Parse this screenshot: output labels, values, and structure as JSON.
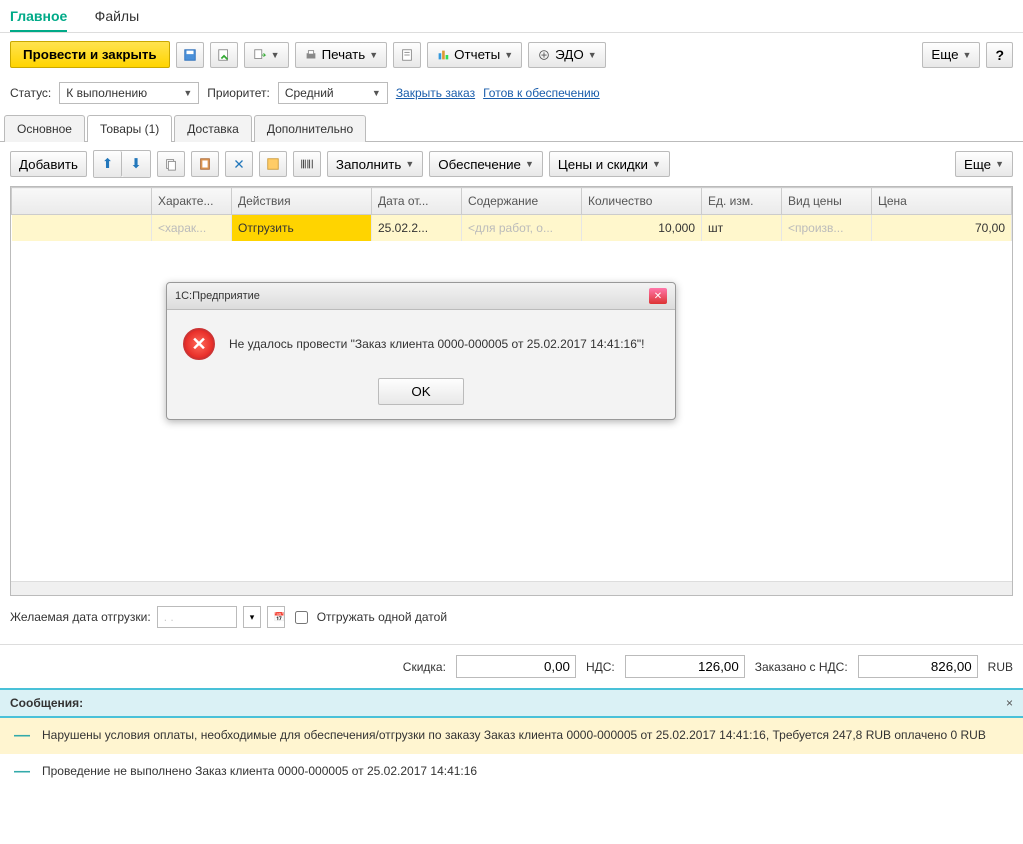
{
  "nav": {
    "main": "Главное",
    "files": "Файлы"
  },
  "toolbar": {
    "post_close": "Провести и закрыть",
    "print": "Печать",
    "reports": "Отчеты",
    "edo": "ЭДО",
    "more": "Еще",
    "help": "?"
  },
  "status": {
    "label": "Статус:",
    "value": "К выполнению",
    "priority_label": "Приоритет:",
    "priority_value": "Средний",
    "close_order": "Закрыть заказ",
    "ready_supply": "Готов к обеспечению"
  },
  "tabs": {
    "main": "Основное",
    "goods": "Товары (1)",
    "delivery": "Доставка",
    "extra": "Дополнительно"
  },
  "gridbar": {
    "add": "Добавить",
    "fill": "Заполнить",
    "supply": "Обеспечение",
    "prices": "Цены и скидки",
    "more": "Еще"
  },
  "columns": {
    "c1": "Характе...",
    "c2": "Действия",
    "c3": "Дата от...",
    "c4": "Содержание",
    "c5": "Количество",
    "c6": "Ед. изм.",
    "c7": "Вид цены",
    "c8": "Цена"
  },
  "row": {
    "char": "<харак...",
    "action": "Отгрузить",
    "date": "25.02.2...",
    "content": "<для работ, о...",
    "qty": "10,000",
    "unit": "шт",
    "price_type": "<произв...",
    "price": "70,00"
  },
  "dialog": {
    "title": "1С:Предприятие",
    "msg": "Не удалось провести \"Заказ клиента 0000-000005 от 25.02.2017 14:41:16\"!",
    "ok": "OK"
  },
  "ship": {
    "label": "Желаемая дата отгрузки:",
    "mask": " . .",
    "one_date": "Отгружать одной датой"
  },
  "totals": {
    "discount_label": "Скидка:",
    "discount": "0,00",
    "vat_label": "НДС:",
    "vat": "126,00",
    "ordered_label": "Заказано с НДС:",
    "ordered": "826,00",
    "currency": "RUB"
  },
  "messages": {
    "title": "Сообщения:",
    "m1": "Нарушены условия оплаты, необходимые для обеспечения/отгрузки по заказу Заказ клиента 0000-000005 от 25.02.2017 14:41:16, Требуется 247,8 RUB оплачено 0 RUB",
    "m2": "Проведение не выполнено Заказ клиента 0000-000005 от 25.02.2017 14:41:16"
  }
}
